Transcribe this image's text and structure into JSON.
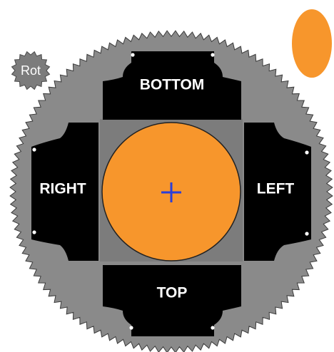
{
  "panels": {
    "bottom": "BOTTOM",
    "right": "RIGHT",
    "left": "LEFT",
    "top": "TOP"
  },
  "rotate_button": {
    "label": "Rot"
  },
  "colors": {
    "gear_fill": "#8a8a8a",
    "gear_stroke": "#3a3a3a",
    "panel_fill": "#000000",
    "center_fill": "#f7962c",
    "crosshair": "#2b3fd8",
    "swatch": "#f7962c",
    "rot_fill": "#7c7c7c",
    "inner_square": "#7c7c7c"
  },
  "icons": {
    "center_marker": "crosshair-plus-icon",
    "rotate": "rotate-gear-icon",
    "color_preview": "orange-ellipse-swatch"
  }
}
